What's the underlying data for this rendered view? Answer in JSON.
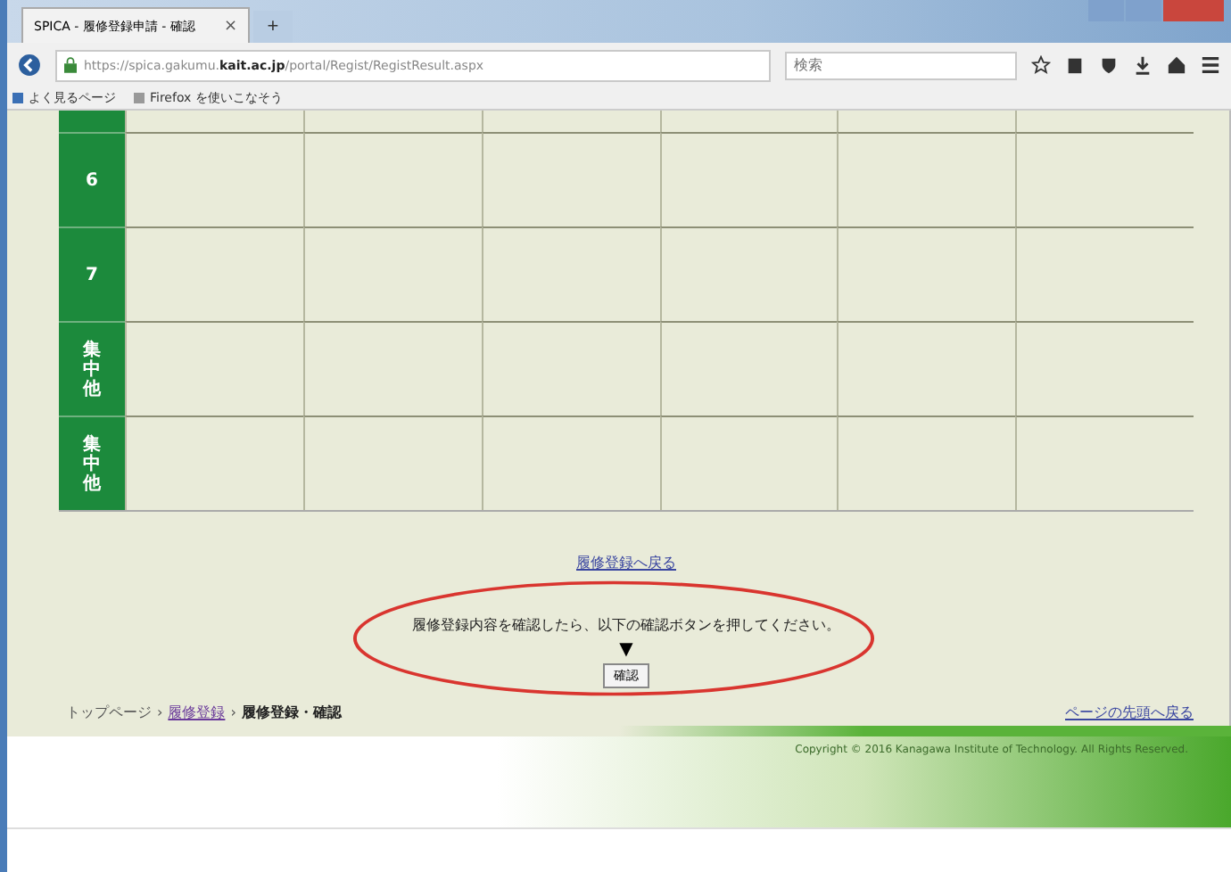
{
  "browser": {
    "tab_title": "SPICA - 履修登録申請 - 確認",
    "tab_close": "×",
    "new_tab": "+",
    "url_prefix": "https://spica.gakumu.",
    "url_domain": "kait.ac.jp",
    "url_path": "/portal/Regist/RegistResult.aspx",
    "search_placeholder": "検索",
    "bookmarks": [
      "よく見るページ",
      "Firefox を使いこなそう"
    ]
  },
  "timetable": {
    "rows": [
      {
        "label": "6"
      },
      {
        "label": "7"
      },
      {
        "label": "集中他"
      },
      {
        "label": "集中他"
      }
    ]
  },
  "back_link": "履修登録へ戻る",
  "message": "履修登録内容を確認したら、以下の確認ボタンを押してください。",
  "arrow": "▼",
  "confirm_button": "確認",
  "breadcrumb_separator": "›",
  "breadcrumb": [
    {
      "label": "トップページ",
      "link": false
    },
    {
      "label": "履修登録",
      "link": true
    },
    {
      "label": "履修登録・確認",
      "link": false
    }
  ],
  "page_top_link": "ページの先頭へ戻る",
  "copyright": "Copyright © 2016 Kanagawa Institute of Technology. All Rights Reserved.",
  "annotation": {
    "kind": "ellipse",
    "color": "#d9352f"
  }
}
